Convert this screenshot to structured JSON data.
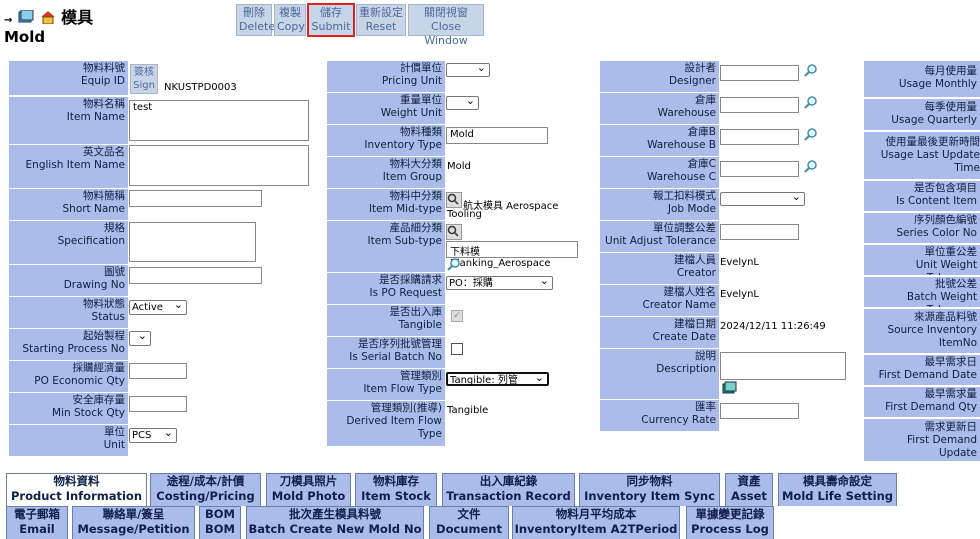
{
  "header": {
    "title_zh": "模具",
    "title_en": "Mold"
  },
  "toolbar": [
    {
      "zh": "刪除",
      "en": "Delete"
    },
    {
      "zh": "複製",
      "en": "Copy"
    },
    {
      "zh": "儲存",
      "en": "Submit"
    },
    {
      "zh": "重新設定",
      "en": "Reset"
    },
    {
      "zh": "關閉視窗",
      "en": "Close Window"
    }
  ],
  "col1": {
    "item_no": {
      "zh": "物料料號",
      "en": "Equip ID",
      "sign_zh": "簽核",
      "sign_en": "Sign",
      "value": "NKUSTPD0003"
    },
    "item_name": {
      "zh": "物料名稱",
      "en": "Item Name",
      "value": "test"
    },
    "eng_name": {
      "zh": "英文品名",
      "en": "English Item Name"
    },
    "short_name": {
      "zh": "物料簡稱",
      "en": "Short Name"
    },
    "spec": {
      "zh": "規格",
      "en": "Specification"
    },
    "drawing": {
      "zh": "圖號",
      "en": "Drawing No"
    },
    "status": {
      "zh": "物料狀態",
      "en": "Status",
      "value": "Active"
    },
    "start_proc": {
      "zh": "起始製程",
      "en": "Starting Process No"
    },
    "po_qty": {
      "zh": "採購經濟量",
      "en": "PO Economic Qty"
    },
    "safety": {
      "zh": "安全庫存量",
      "en": "Min Stock Qty"
    },
    "unit": {
      "zh": "單位",
      "en": "Unit",
      "value": "PCS"
    }
  },
  "col2": {
    "pricing_unit": {
      "zh": "計價單位",
      "en": "Pricing Unit"
    },
    "weight_unit": {
      "zh": "重量單位",
      "en": "Weight Unit"
    },
    "inv_type": {
      "zh": "物料種類",
      "en": "Inventory Type",
      "value": "Mold"
    },
    "group": {
      "zh": "物料大分類",
      "en": "Item Group",
      "value": "Mold"
    },
    "mid": {
      "zh": "物料中分類",
      "en": "Item Mid-type",
      "value1": "航太模具 Aerospace",
      "value2": "Tooling"
    },
    "sub": {
      "zh": "產品細分類",
      "en": "Item Sub-type",
      "value": "下料模 Blanking_Aerospace"
    },
    "po_req": {
      "zh": "是否採購請求",
      "en": "Is PO Request",
      "value": "PO：採購"
    },
    "tangible": {
      "zh": "是否出入庫",
      "en": "Tangible"
    },
    "serial": {
      "zh": "是否序列批號管理",
      "en": "Is Serial Batch No"
    },
    "flow": {
      "zh": "管理類別",
      "en": "Item Flow Type",
      "value": "Tangible: 列管"
    },
    "derived": {
      "zh": "管理類別(推導)",
      "en": "Derived Item Flow Type",
      "value": "Tangible"
    }
  },
  "col3": {
    "designer": {
      "zh": "設計者",
      "en": "Designer"
    },
    "warehouse": {
      "zh": "倉庫",
      "en": "Warehouse"
    },
    "warehouse_b": {
      "zh": "倉庫B",
      "en": "Warehouse B"
    },
    "warehouse_c": {
      "zh": "倉庫C",
      "en": "Warehouse C"
    },
    "job_mode": {
      "zh": "報工扣料模式",
      "en": "Job Mode"
    },
    "tolerance": {
      "zh": "單位調整公差",
      "en": "Unit Adjust Tolerance"
    },
    "creator": {
      "zh": "建檔人員",
      "en": "Creator",
      "value": "EvelynL"
    },
    "creator_name": {
      "zh": "建檔人姓名",
      "en": "Creator Name",
      "value": "EvelynL"
    },
    "create_date": {
      "zh": "建檔日期",
      "en": "Create Date",
      "value": "2024/12/11 11:26:49"
    },
    "description": {
      "zh": "說明",
      "en": "Description"
    },
    "currency": {
      "zh": "匯率",
      "en": "Currency Rate"
    }
  },
  "col4": [
    {
      "zh": "每月使用量",
      "en": "Usage Monthly"
    },
    {
      "zh": "每季使用量",
      "en": "Usage Quarterly"
    },
    {
      "zh": "使用量最後更新時間",
      "en": "Usage Last Update Time"
    },
    {
      "zh": "是否包含項目",
      "en": "Is Content Item"
    },
    {
      "zh": "序列顏色編號",
      "en": "Series Color No"
    },
    {
      "zh": "單位重公差",
      "en": "Unit Weight Tolerance"
    },
    {
      "zh": "批號公差",
      "en": "Batch Weight Tolerance"
    },
    {
      "zh": "來源產品料號",
      "en": "Source Inventory ItemNo"
    },
    {
      "zh": "最早需求日",
      "en": "First Demand Date"
    },
    {
      "zh": "最早需求量",
      "en": "First Demand Qty"
    },
    {
      "zh": "需求更新日",
      "en": "First Demand Update"
    }
  ],
  "tabs_row1": [
    {
      "zh": "物料資料",
      "en": "Product Information"
    },
    {
      "zh": "途程/成本/計價",
      "en": "Costing/Pricing"
    },
    {
      "zh": "刀模具照片",
      "en": "Mold Photo"
    },
    {
      "zh": "物料庫存",
      "en": "Item Stock"
    },
    {
      "zh": "出入庫紀錄",
      "en": "Transaction Record"
    },
    {
      "zh": "同步物料",
      "en": "Inventory Item Sync"
    },
    {
      "zh": "資產",
      "en": "Asset"
    },
    {
      "zh": "模具壽命設定",
      "en": "Mold Life Setting"
    }
  ],
  "tabs_row2": [
    {
      "zh": "電子郵箱",
      "en": "Email"
    },
    {
      "zh": "聯絡單/簽呈",
      "en": "Message/Petition"
    },
    {
      "zh": "BOM",
      "en": "BOM"
    },
    {
      "zh": "批次產生模具料號",
      "en": "Batch Create New Mold No"
    },
    {
      "zh": "文件",
      "en": "Document"
    },
    {
      "zh": "物料月平均成本",
      "en": "InventoryItem A2TPeriod"
    },
    {
      "zh": "單據變更記錄",
      "en": "Process Log"
    }
  ]
}
